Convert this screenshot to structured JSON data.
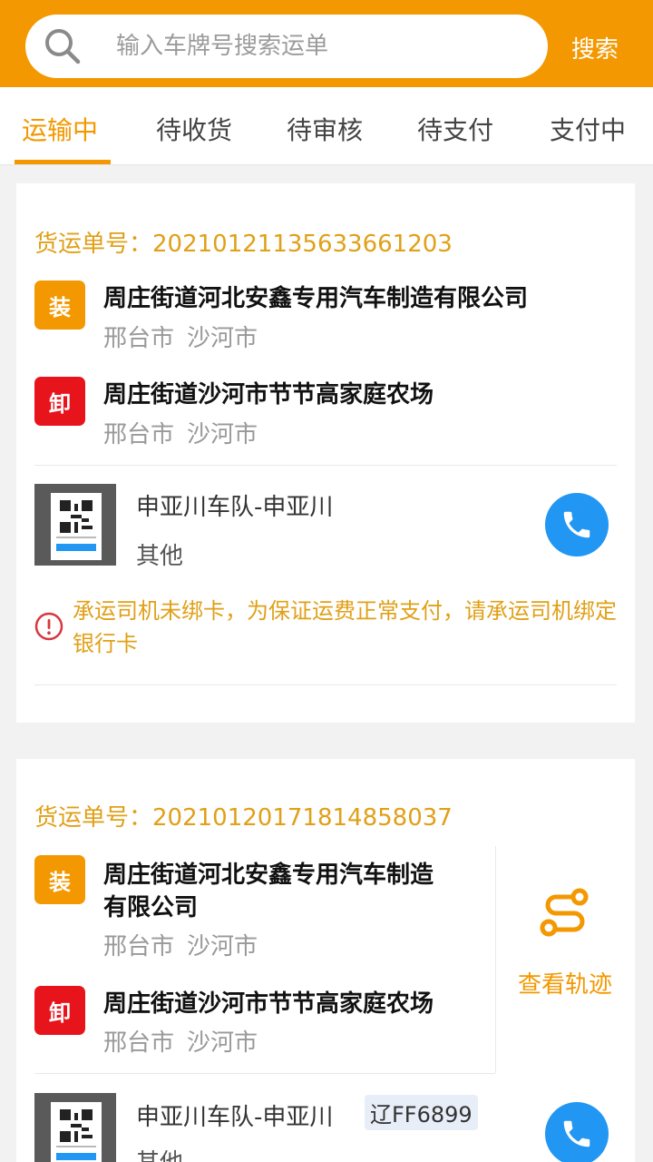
{
  "search": {
    "placeholder": "输入车牌号搜索运单",
    "value": "",
    "button_label": "搜索"
  },
  "tabs": [
    {
      "label": "运输中",
      "active": true
    },
    {
      "label": "待收货",
      "active": false
    },
    {
      "label": "待审核",
      "active": false
    },
    {
      "label": "待支付",
      "active": false
    },
    {
      "label": "支付中",
      "active": false
    }
  ],
  "orders": [
    {
      "waybill": "货运单号：20210121135633661203",
      "load": {
        "badge": "装",
        "company": "周庄街道河北安鑫专用汽车制造有限公司",
        "city": "邢台市",
        "district": "沙河市"
      },
      "unload": {
        "badge": "卸",
        "company": "周庄街道沙河市节节高家庭农场",
        "city": "邢台市",
        "district": "沙河市"
      },
      "driver": "申亚川车队-申亚川",
      "vehicle_type": "其他",
      "warning": "承运司机未绑卡，为保证运费正常支付，请承运司机绑定银行卡"
    },
    {
      "waybill": "货运单号：20210120171814858037",
      "load": {
        "badge": "装",
        "company_line1": "周庄街道河北安鑫专用汽车制造",
        "company_line2": "有限公司",
        "city": "邢台市",
        "district": "沙河市"
      },
      "unload": {
        "badge": "卸",
        "company": "周庄街道沙河市节节高家庭农场",
        "city": "邢台市",
        "district": "沙河市"
      },
      "track_label": "查看轨迹",
      "driver": "申亚川车队-申亚川",
      "plate": "辽FF6899",
      "vehicle_type": "其他"
    }
  ],
  "colors": {
    "accent": "#f39800",
    "unload": "#e8141c",
    "phone": "#2196f3",
    "warning": "#e0a018"
  },
  "icons": [
    "search-icon",
    "phone-icon",
    "warning-icon",
    "route-icon",
    "qr-code-icon"
  ]
}
